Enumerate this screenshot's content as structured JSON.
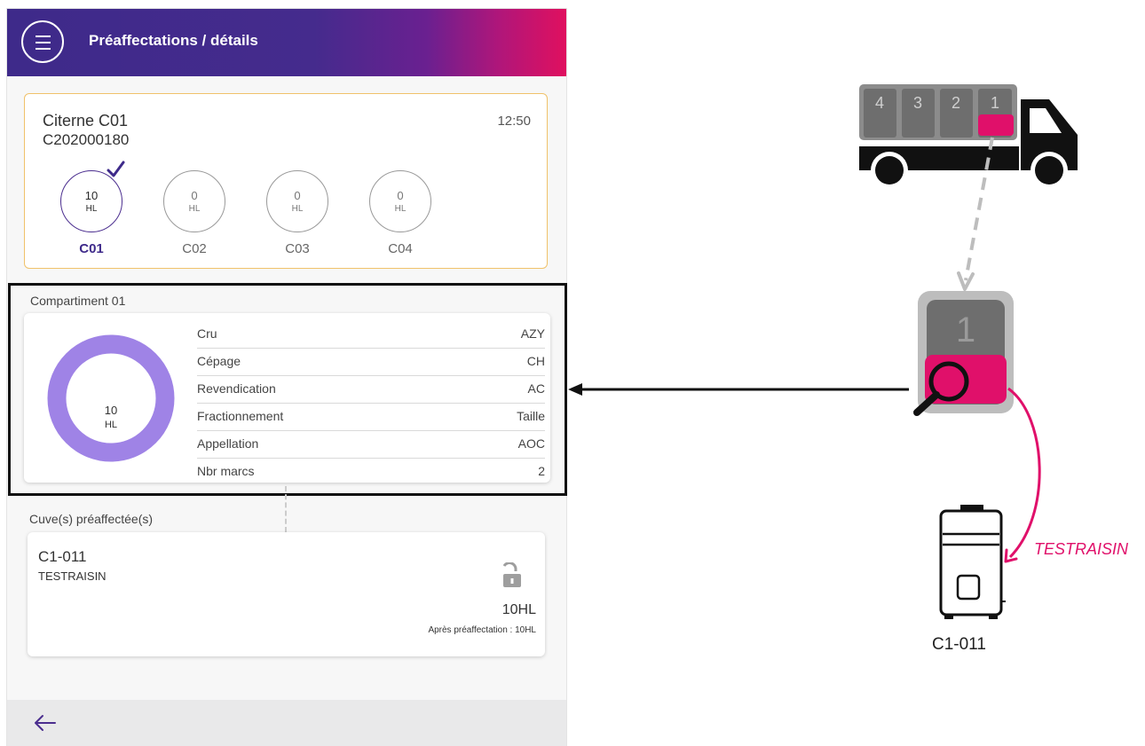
{
  "appbar": {
    "title": "Préaffectations / détails",
    "menu_icon": "menu-icon"
  },
  "citerne": {
    "name": "Citerne C01",
    "code": "C202000180",
    "time": "12:50",
    "border_color": "#f0c26a",
    "compartments": [
      {
        "value": "10",
        "unit": "HL",
        "label": "C01",
        "active": true
      },
      {
        "value": "0",
        "unit": "HL",
        "label": "C02",
        "active": false
      },
      {
        "value": "0",
        "unit": "HL",
        "label": "C03",
        "active": false
      },
      {
        "value": "0",
        "unit": "HL",
        "label": "C04",
        "active": false
      }
    ]
  },
  "compartiment": {
    "title": "Compartiment 01",
    "volume_value": "10",
    "volume_unit": "HL",
    "donut_color": "#9f83e6",
    "properties": [
      {
        "key": "Cru",
        "value": "AZY"
      },
      {
        "key": "Cépage",
        "value": "CH"
      },
      {
        "key": "Revendication",
        "value": "AC"
      },
      {
        "key": "Fractionnement",
        "value": "Taille"
      },
      {
        "key": "Appellation",
        "value": "AOC"
      },
      {
        "key": "Nbr marcs",
        "value": "2"
      }
    ]
  },
  "cuves": {
    "title": "Cuve(s) préaffectée(s)",
    "items": [
      {
        "name": "C1-011",
        "sub": "TESTRAISIN",
        "volume": "10HL",
        "after": "Après préaffectation : 10HL",
        "icon": "unlock-icon"
      }
    ]
  },
  "bottom": {
    "back_icon": "arrow-left-icon"
  },
  "diagram": {
    "truck_slots": [
      "4",
      "3",
      "2",
      "1"
    ],
    "compartment_number": "1",
    "wine_label": "TESTRAISIN",
    "tank_label": "C1-011",
    "accent_color": "#e0106a",
    "brand_purple": "#3e2a8a"
  }
}
